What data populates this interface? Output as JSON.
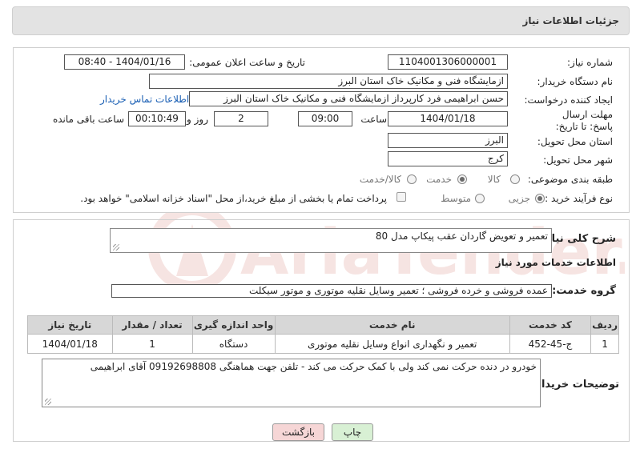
{
  "header": {
    "title": "جزئیات اطلاعات نیاز"
  },
  "form": {
    "need_number": {
      "label": "شماره نیاز:",
      "value": "1104001306000001"
    },
    "announce": {
      "label": "تاریخ و ساعت اعلان عمومی:",
      "value": "1404/01/16 - 08:40"
    },
    "buyer_org": {
      "label": "نام دستگاه خریدار:",
      "value": "ازمایشگاه فنی و مکانیک خاک استان البرز"
    },
    "requester": {
      "label": "ایجاد کننده درخواست:",
      "value": "حسن ابراهیمی فرد کارپرداز ازمایشگاه فنی و مکانیک خاک استان البرز"
    },
    "contact_link": "اطلاعات تماس خریدار",
    "deadline": {
      "label": "مهلت ارسال پاسخ: تا تاریخ:",
      "date": "1404/01/18",
      "time_label": "ساعت",
      "time": "09:00",
      "days": "2",
      "days_label": "روز و",
      "remaining": "00:10:49",
      "remaining_label": "ساعت باقی مانده"
    },
    "province": {
      "label": "استان محل تحویل:",
      "value": "البرز"
    },
    "city": {
      "label": "شهر محل تحویل:",
      "value": "کرج"
    },
    "category": {
      "label": "طبقه بندی موضوعی:",
      "options": [
        "کالا",
        "خدمت",
        "کالا/خدمت"
      ],
      "selected": "خدمت"
    },
    "process": {
      "label": "نوع فرآیند خرید :",
      "options": [
        "جزیی",
        "متوسط"
      ],
      "selected": "جزیی",
      "payment_note": "پرداخت تمام یا بخشی از مبلغ خرید،از محل \"اسناد خزانه اسلامی\" خواهد بود."
    }
  },
  "description": {
    "label": "شرح کلی نیاز:",
    "value": "تعمیر و تعویض گاردان عقب پیکاپ مدل 80"
  },
  "services": {
    "title": "اطلاعات خدمات مورد نیاز",
    "group_label": "گروه خدمت:",
    "group_value": "عمده فروشی و خرده فروشی ؛ تعمیر وسایل نقلیه موتوری و موتور سیکلت",
    "columns": [
      "ردیف",
      "کد خدمت",
      "نام خدمت",
      "واحد اندازه گیری",
      "تعداد / مقدار",
      "تاریخ نیاز"
    ],
    "rows": [
      {
        "row": "1",
        "code": "ج-45-452",
        "name": "تعمیر و نگهداری انواع وسایل نقلیه موتوری",
        "unit": "دستگاه",
        "qty": "1",
        "date": "1404/01/18"
      }
    ]
  },
  "buyer_notes": {
    "label": "توضیحات خریدار:",
    "value": "خودرو در دنده حرکت نمی کند ولی با کمک حرکت می کند - تلفن جهت هماهنگی 09192698808 آقای ابراهیمی"
  },
  "buttons": {
    "print": "چاپ",
    "back": "بازگشت"
  },
  "watermark": "AriaTender.neT",
  "colors": {
    "header_bg": "#e3e3e3",
    "link": "#1a5fb4",
    "back_btn": "#f6d6d6",
    "print_btn": "#d8f0d4",
    "watermark": "#c0392b"
  }
}
